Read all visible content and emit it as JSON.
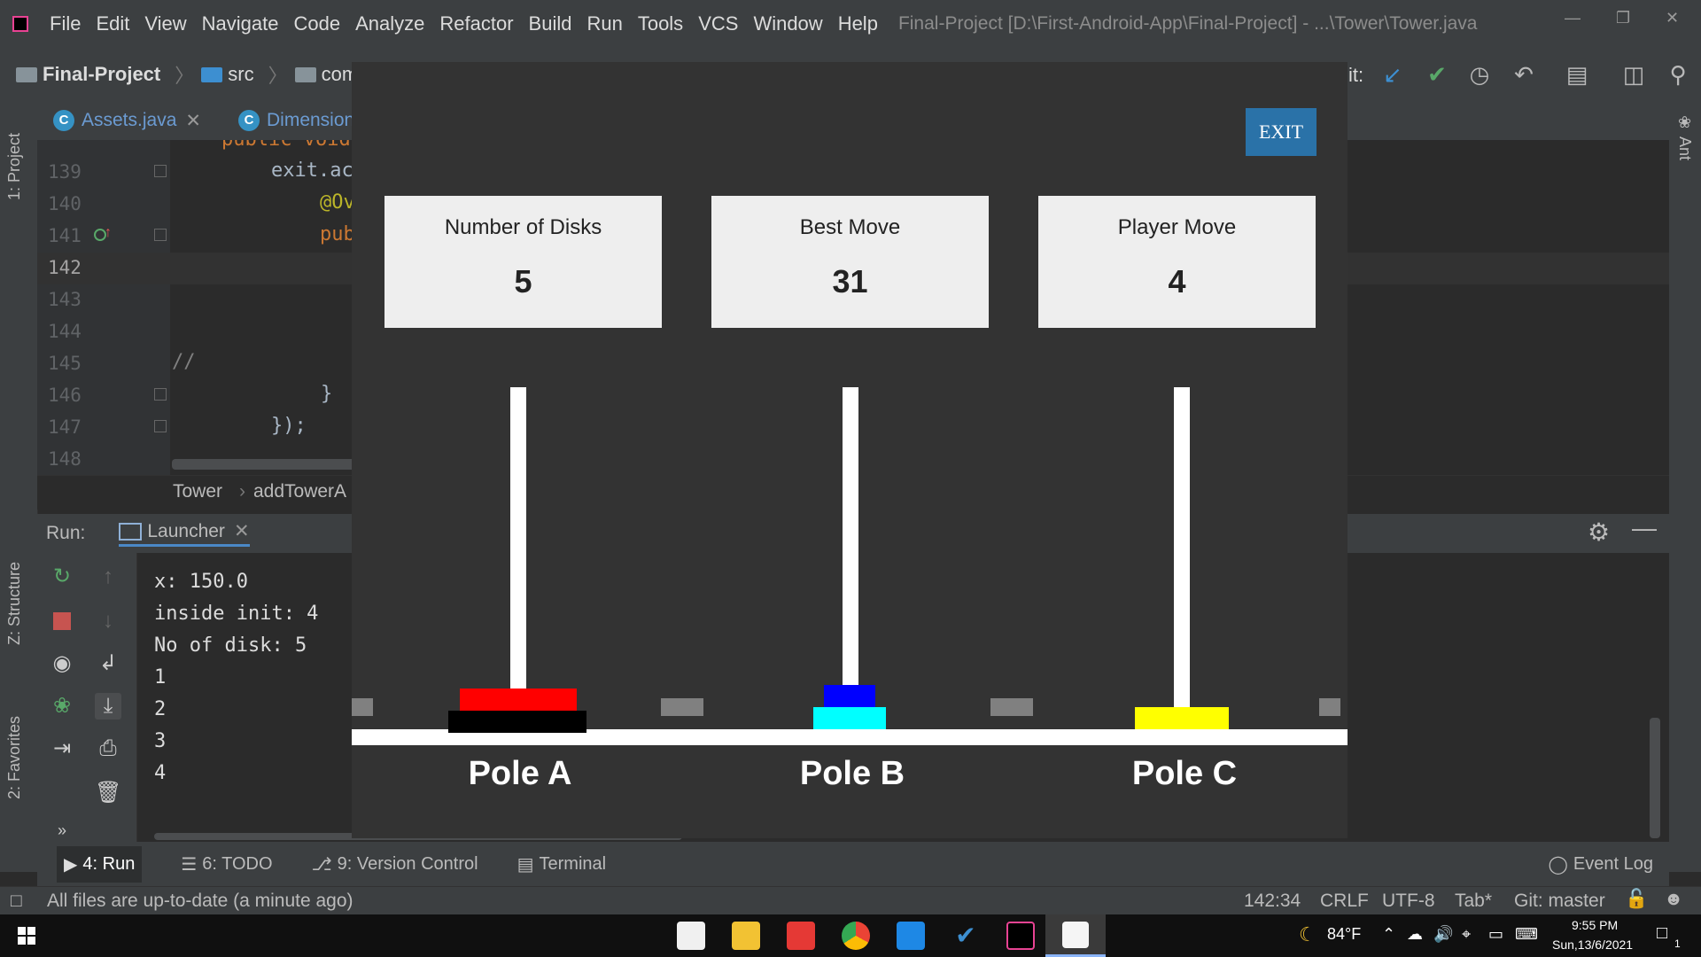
{
  "menu": {
    "items": [
      "File",
      "Edit",
      "View",
      "Navigate",
      "Code",
      "Analyze",
      "Refactor",
      "Build",
      "Run",
      "Tools",
      "VCS",
      "Window",
      "Help"
    ],
    "window_title": "Final-Project [D:\\First-Android-App\\Final-Project] - ...\\Tower\\Tower.java"
  },
  "navbar": {
    "project": "Final-Project",
    "crumbs": [
      "src",
      "com"
    ],
    "partial_label": "it:"
  },
  "editor": {
    "tabs": [
      {
        "label": "Assets.java",
        "icon": "class-icon"
      },
      {
        "label": "Dimension.j",
        "icon": "class-icon"
      }
    ],
    "line_numbers": [
      "139",
      "140",
      "141",
      "142",
      "143",
      "144",
      "145",
      "146",
      "147",
      "148"
    ],
    "lines": {
      "l139": "exit.ac",
      "l140": "@Ov",
      "l141": "pub",
      "l145": "//",
      "l146": "}",
      "l147": "});",
      "partial_top": "public void"
    },
    "breadcrumb": [
      "Tower",
      "addTowerA"
    ]
  },
  "run_panel": {
    "label": "Run:",
    "tab": "Launcher",
    "console": [
      "x: 150.0",
      "inside init: 4",
      "No of disk: 5",
      "1",
      "2",
      "3",
      "4"
    ]
  },
  "left_strip": {
    "project": "1: Project",
    "structure": "Z: Structure",
    "favorites": "2: Favorites"
  },
  "right_strip": {
    "ant": "Ant"
  },
  "tool_tabs": {
    "run": "4: Run",
    "todo": "6: TODO",
    "vcs": "9: Version Control",
    "terminal": "Terminal",
    "event_log": "Event Log"
  },
  "status": {
    "message": "All files are up-to-date (a minute ago)",
    "position": "142:34",
    "line_sep": "CRLF",
    "encoding": "UTF-8",
    "indent": "Tab*",
    "git": "Git: master"
  },
  "taskbar": {
    "temperature": "84°F",
    "time": "9:55 PM",
    "date": "Sun,13/6/2021",
    "notif_count": "1"
  },
  "game": {
    "exit_label": "EXIT",
    "cards": [
      {
        "label": "Number of Disks",
        "value": "5"
      },
      {
        "label": "Best Move",
        "value": "31"
      },
      {
        "label": "Player Move",
        "value": "4"
      }
    ],
    "poles": [
      {
        "label": "Pole A",
        "disks": [
          {
            "color": "#ff0000"
          },
          {
            "color": "#000000"
          }
        ]
      },
      {
        "label": "Pole B",
        "disks": [
          {
            "color": "#0000ff"
          },
          {
            "color": "#00ffff"
          }
        ]
      },
      {
        "label": "Pole C",
        "disks": [
          {
            "color": "#ffff00"
          }
        ]
      }
    ],
    "colors": {
      "exit": "#2a72a8",
      "board": "#333333",
      "card": "#eeeeee"
    }
  }
}
